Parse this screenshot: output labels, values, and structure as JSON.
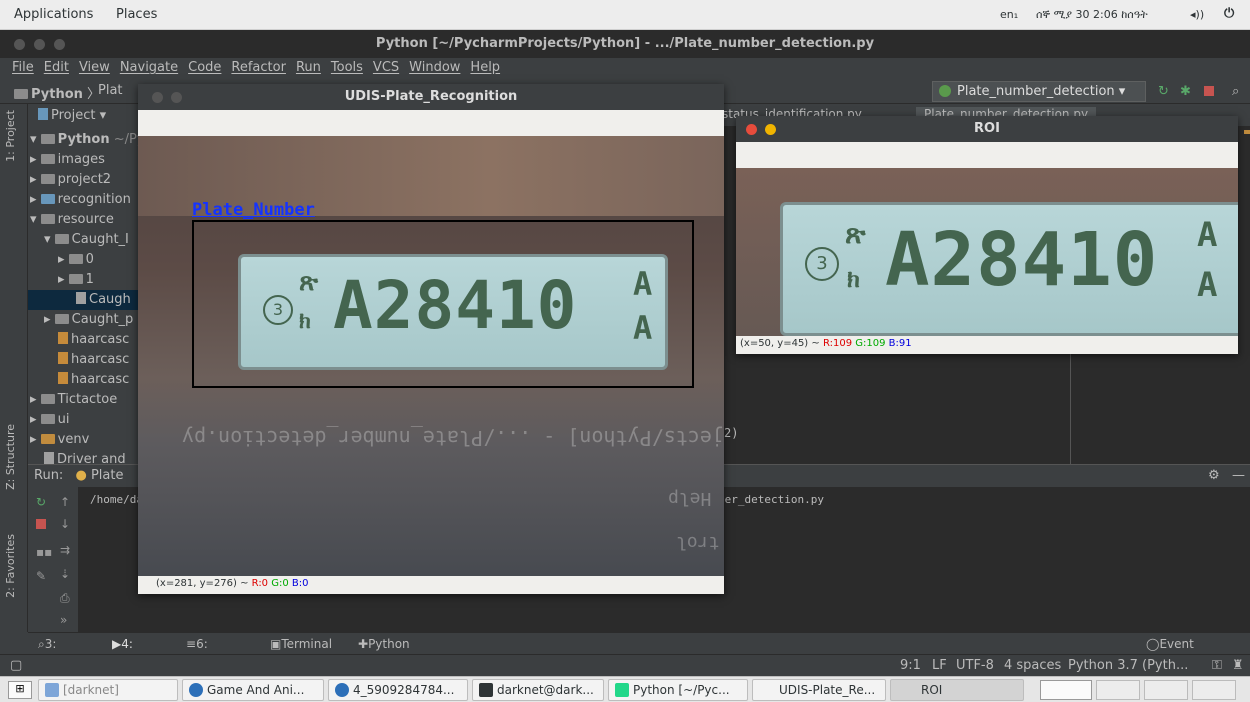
{
  "topbar": {
    "applications": "Applications",
    "places": "Places",
    "keyboard": "en₁",
    "clock": "ሰኞ ሚያ 30 2:06 ከሰዓት",
    "volume_icon": "volume-icon",
    "power_icon": "power-icon"
  },
  "pycharm": {
    "title": "Python [~/PycharmProjects/Python] - .../Plate_number_detection.py",
    "menu": [
      "File",
      "Edit",
      "View",
      "Navigate",
      "Code",
      "Refactor",
      "Run",
      "Tools",
      "VCS",
      "Window",
      "Help"
    ],
    "breadcrumb": {
      "project": "Python",
      "file": "Plat"
    },
    "run_config": "Plate_number_detection",
    "tab_left": "status_identification.py",
    "tab_right": "Plate_number_detection.py",
    "left_labels": {
      "project": "1: Project",
      "structure": "Z: Structure",
      "favorites": "2: Favorites"
    },
    "project_panel": {
      "header": "Project",
      "root_name": "Python",
      "root_path": "~/Py",
      "items": [
        "images",
        "project2",
        "recognition",
        "resource",
        "Caught_I",
        "0",
        "1",
        "Caugh",
        "Caught_p",
        "haarcasc",
        "haarcasc",
        "haarcasc",
        "Tictactoe",
        "ui",
        "venv",
        "Driver and"
      ]
    },
    "run_panel": {
      "label": "Run:",
      "tab": "Plate",
      "console_path": "/home/da",
      "console_tail": "ber_detection.py"
    },
    "editor_fragment": "2)",
    "bottom_tabs": [
      "3: Find",
      "4: Run",
      "6: TODO",
      "Terminal",
      "Python Console"
    ],
    "event_log": "Event Log",
    "status": {
      "position": "9:1",
      "line_sep": "LF",
      "encoding": "UTF-8",
      "indent": "4 spaces",
      "interpreter": "Python 3.7 (Pyth..."
    }
  },
  "recognition_window": {
    "title": "UDIS-Plate_Recognition",
    "label": "Plate_Number",
    "plate_text": "A28410",
    "plate_small": "ክ",
    "plate_symbol": "ጽ",
    "plate_circle": "3",
    "plate_suffix_top": "A",
    "plate_suffix_bottom": "A",
    "ghost_text": "rmProjects/Python] - .../Plate_number_detection.py",
    "ghost_help": "Help",
    "ghost_ctl": "trol",
    "coords": {
      "x": "(x=281, y=276) ~ ",
      "r": "R:0",
      "g": "G:0",
      "b": "B:0"
    }
  },
  "roi_window": {
    "title": "ROI",
    "plate_text": "A28410",
    "plate_small": "ክ",
    "plate_symbol": "ጽ",
    "plate_circle": "3",
    "plate_suffix_top": "A",
    "plate_suffix_bottom": "A",
    "coords": {
      "x": "(x=50, y=45) ~ ",
      "r": "R:109",
      "g": "G:109",
      "b": "B:91"
    }
  },
  "taskbar": {
    "items": [
      "[darknet]",
      "Game And Ani...",
      "4_5909284784...",
      "darknet@dark...",
      "Python [~/Pyc...",
      "UDIS-Plate_Re...",
      "ROI"
    ]
  },
  "colors": {
    "box_label": "#1433ff",
    "plate_bg": "#b0d0d2",
    "plate_ink": "#44654f",
    "ide_bg": "#2b2b2b",
    "ide_panel": "#3c3f41"
  }
}
